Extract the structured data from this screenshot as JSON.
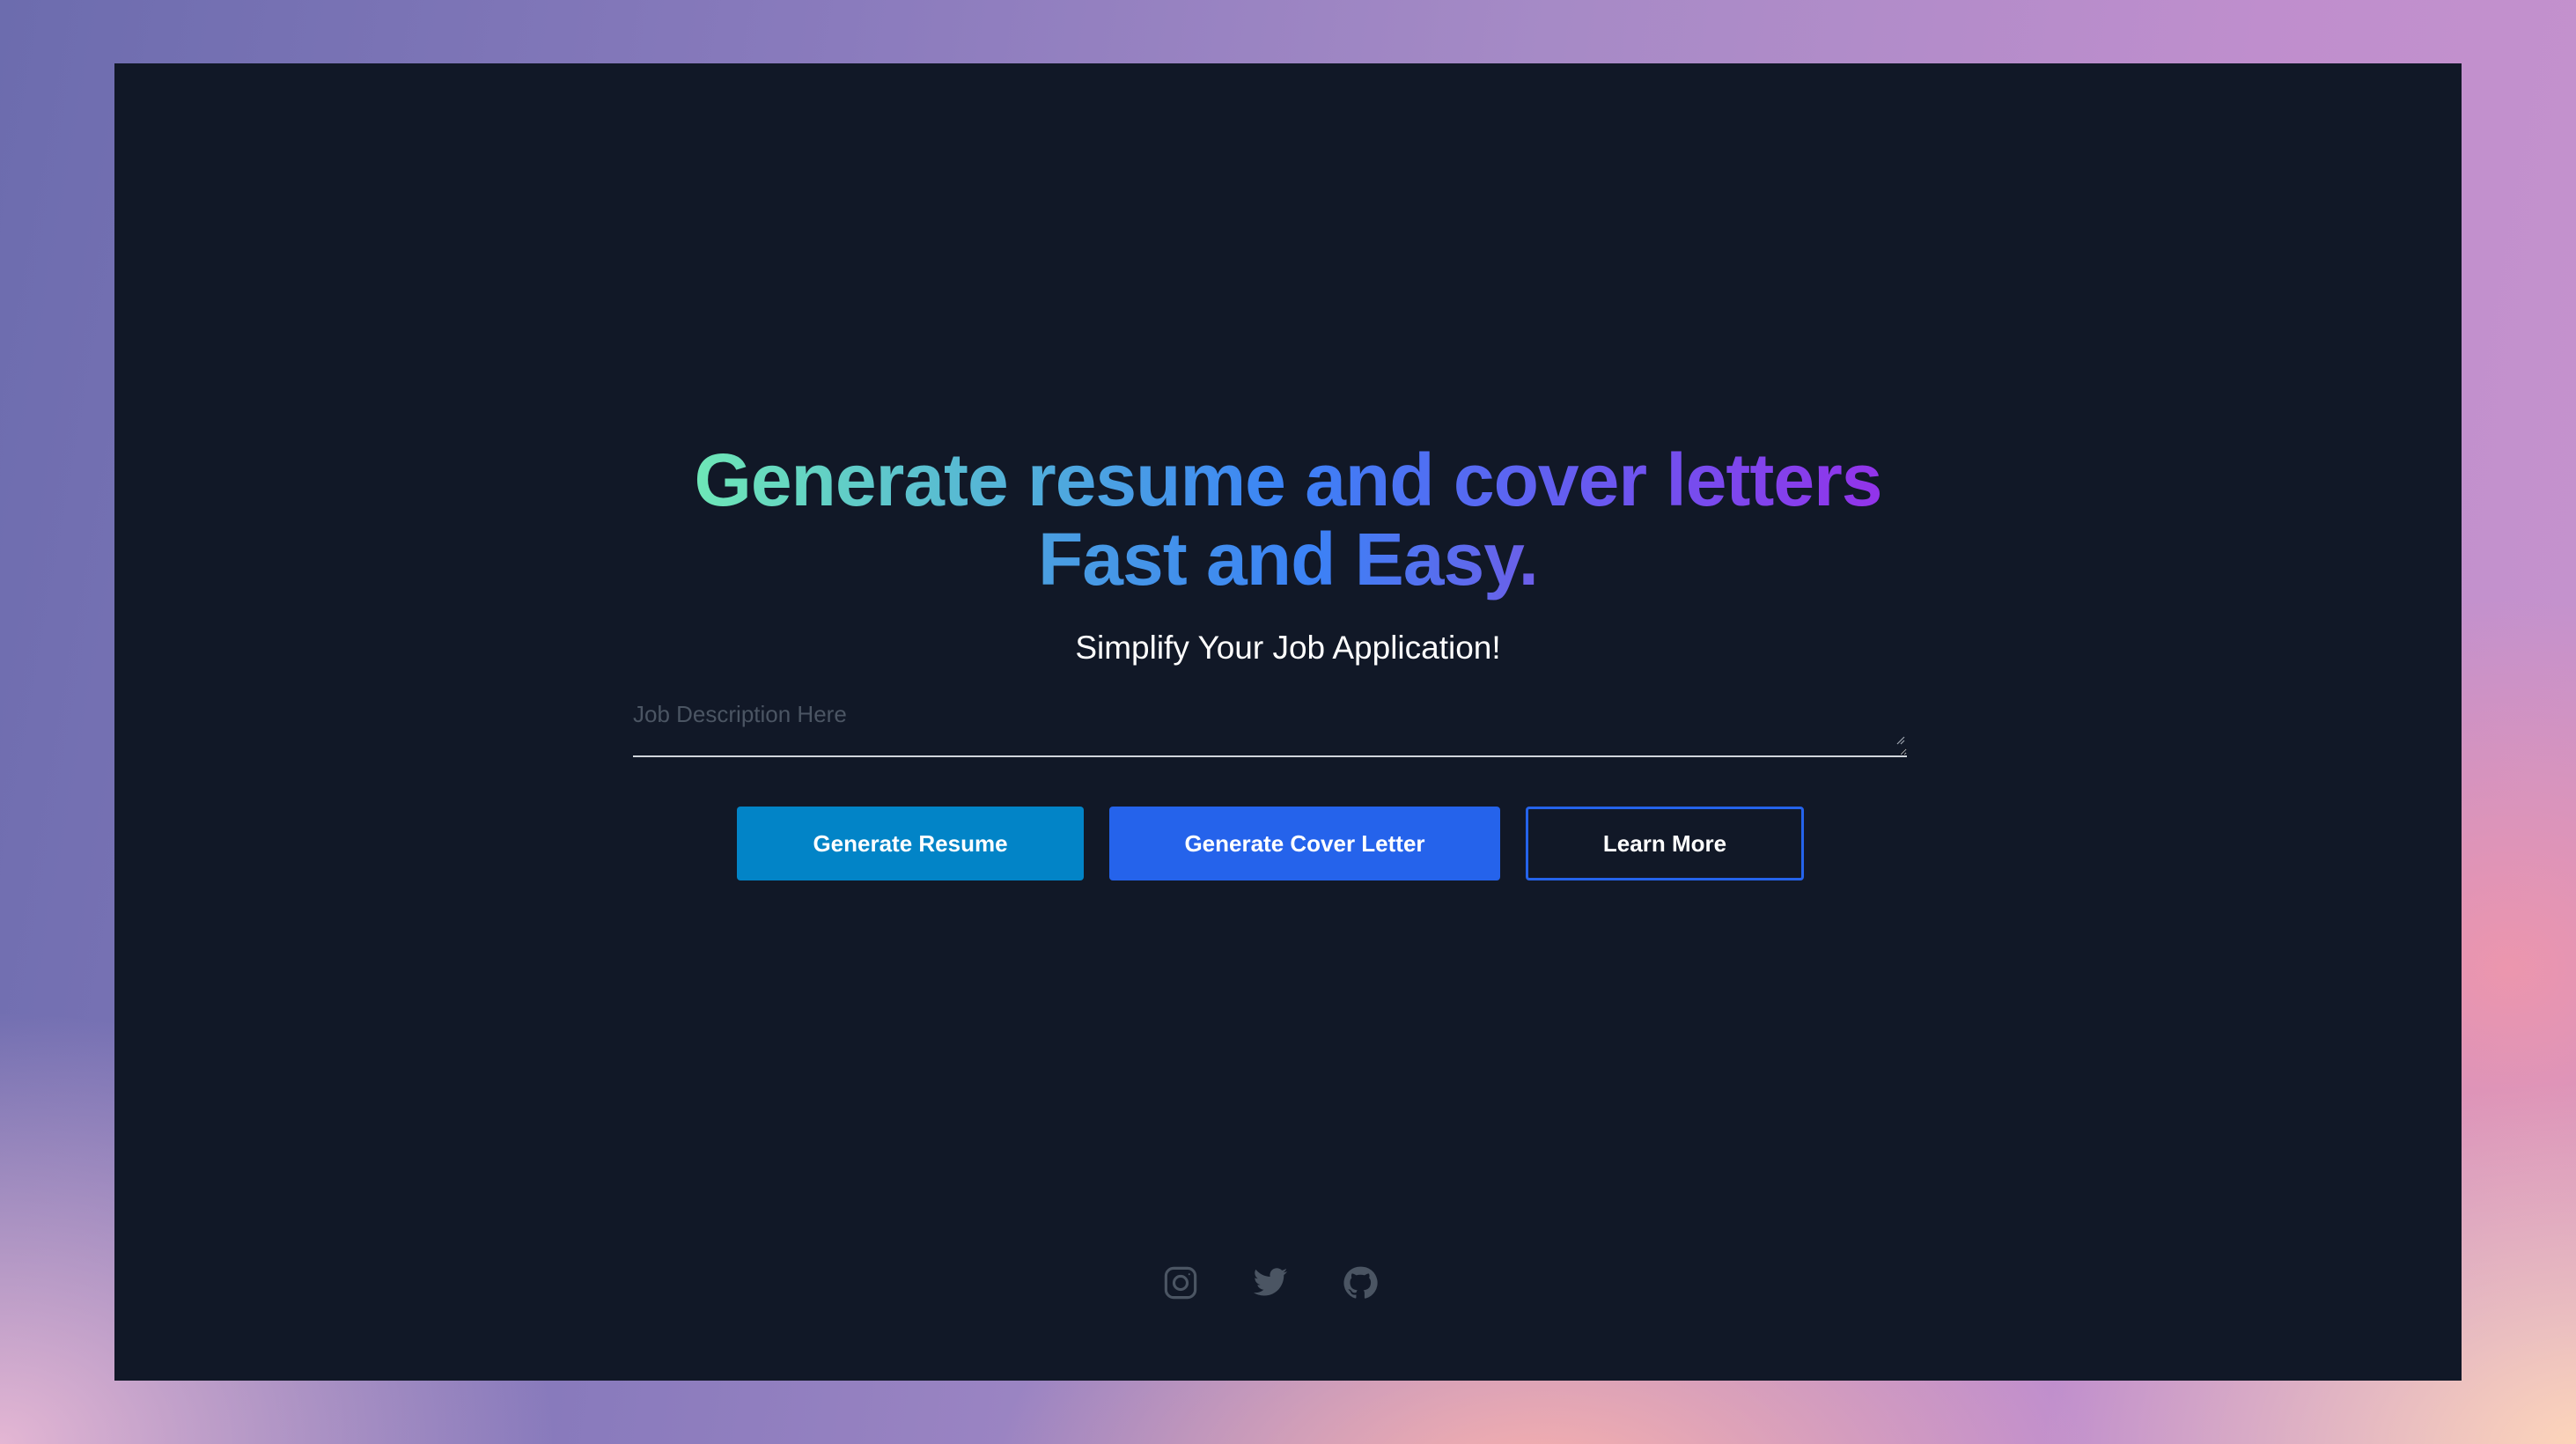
{
  "hero": {
    "headline_line1": "Generate resume and cover letters",
    "headline_line2": "Fast and Easy.",
    "subtitle": "Simplify Your Job Application!"
  },
  "job_description": {
    "placeholder": "Job Description Here",
    "value": ""
  },
  "actions": {
    "generate_resume_label": "Generate Resume",
    "generate_cover_letter_label": "Generate Cover Letter",
    "learn_more_label": "Learn More"
  },
  "social": {
    "icons": [
      "instagram-icon",
      "twitter-icon",
      "github-icon"
    ]
  },
  "colors": {
    "page_background": "#111827",
    "headline_gradient": [
      "#6ee7b7",
      "#3b82f6",
      "#9333ea"
    ],
    "resume_button": "#0284c7",
    "cover_letter_button": "#2563eb",
    "learn_more_border": "#2563eb",
    "social_icon": "#4b5563"
  }
}
